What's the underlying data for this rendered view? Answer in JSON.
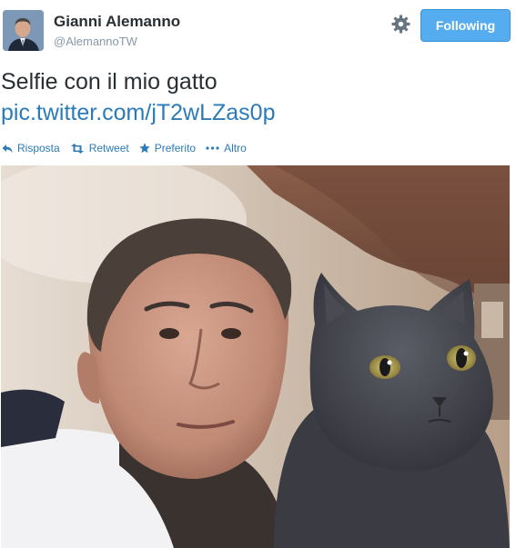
{
  "user": {
    "name": "Gianni Alemanno",
    "handle": "@AlemannoTW"
  },
  "header": {
    "follow_label": "Following"
  },
  "tweet": {
    "text": "Selfie con il mio gatto",
    "link": "pic.twitter.com/jT2wLZas0p"
  },
  "actions": {
    "reply": "Risposta",
    "retweet": "Retweet",
    "favorite": "Preferito",
    "more": "Altro"
  },
  "icons": {
    "settings": "gear-icon",
    "reply": "reply-arrow-icon",
    "retweet": "retweet-icon",
    "favorite": "star-icon",
    "more": "ellipsis-icon"
  },
  "colors": {
    "follow_button": "#55acee",
    "link": "#2b7bb9",
    "handle": "#8899a6",
    "text": "#292f33"
  }
}
